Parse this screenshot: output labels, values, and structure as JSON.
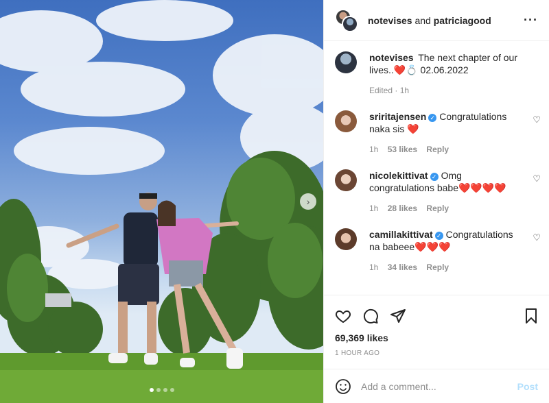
{
  "header": {
    "user1": "notevises",
    "and": "and",
    "user2": "patriciagood",
    "more_icon": "more-horizontal-icon"
  },
  "caption": {
    "user": "notevises",
    "text": "The next chapter of our lives..❤️💍 02.06.2022",
    "edited": "Edited · 1h"
  },
  "comments": [
    {
      "user": "sriritajensen",
      "verified": true,
      "text": "Congratulations naka sis ❤️",
      "time": "1h",
      "likes": "53 likes",
      "reply": "Reply"
    },
    {
      "user": "nicolekittivat",
      "verified": true,
      "text": "Omg congratulations babe❤️❤️❤️❤️",
      "time": "1h",
      "likes": "28 likes",
      "reply": "Reply"
    },
    {
      "user": "camillakittivat",
      "verified": true,
      "text": "Congratulations na babeee❤️❤️❤️",
      "time": "1h",
      "likes": "34 likes",
      "reply": "Reply"
    }
  ],
  "post": {
    "likes": "69,369 likes",
    "time": "1 HOUR AGO"
  },
  "add_comment": {
    "placeholder": "Add a comment...",
    "post_label": "Post"
  },
  "carousel": {
    "next_icon": "chevron-right-icon",
    "slide_count": 4,
    "active_slide": 1
  },
  "colors": {
    "link_blue_disabled": "#b2dffc",
    "verified_blue": "#3897f0",
    "muted_text": "#8e8e8e"
  }
}
